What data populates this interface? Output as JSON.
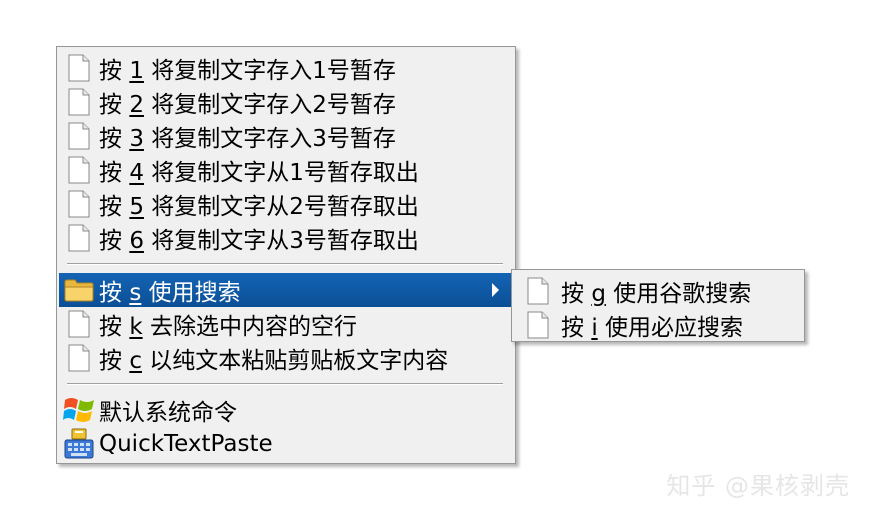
{
  "main_menu": {
    "items": [
      {
        "prefix": "按 ",
        "key": "1",
        "text": " 将复制文字存入1号暂存",
        "icon": "document-icon"
      },
      {
        "prefix": "按 ",
        "key": "2",
        "text": " 将复制文字存入2号暂存",
        "icon": "document-icon"
      },
      {
        "prefix": "按 ",
        "key": "3",
        "text": " 将复制文字存入3号暂存",
        "icon": "document-icon"
      },
      {
        "prefix": "按 ",
        "key": "4",
        "text": " 将复制文字从1号暂存取出",
        "icon": "document-icon"
      },
      {
        "prefix": "按 ",
        "key": "5",
        "text": " 将复制文字从2号暂存取出",
        "icon": "document-icon"
      },
      {
        "prefix": "按 ",
        "key": "6",
        "text": " 将复制文字从3号暂存取出",
        "icon": "document-icon"
      },
      {
        "prefix": "按 ",
        "key": "s",
        "text": " 使用搜索",
        "icon": "folder-icon"
      },
      {
        "prefix": "按 ",
        "key": "k",
        "text": " 去除选中内容的空行",
        "icon": "document-icon"
      },
      {
        "prefix": "按 ",
        "key": "c",
        "text": " 以纯文本粘贴剪贴板文字内容",
        "icon": "document-icon"
      },
      {
        "text": "默认系统命令",
        "icon": "windows-logo-icon"
      },
      {
        "text": "QuickTextPaste",
        "icon": "quicktextpaste-icon"
      }
    ]
  },
  "sub_menu": {
    "items": [
      {
        "prefix": "按 ",
        "key": "g",
        "text": " 使用谷歌搜索",
        "icon": "document-icon"
      },
      {
        "prefix": "按 ",
        "key": "i",
        "text": " 使用必应搜索",
        "icon": "document-icon"
      }
    ]
  },
  "watermark": "知乎 @果核剥壳",
  "colors": {
    "menu_bg": "#f0f0f0",
    "highlight": "#0f5aa8",
    "border": "#979797"
  }
}
